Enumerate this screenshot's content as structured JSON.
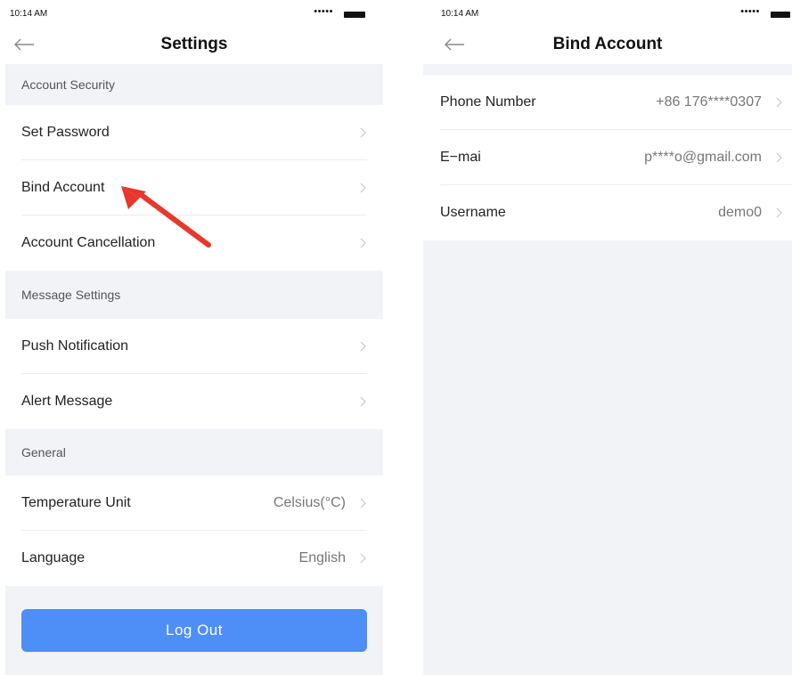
{
  "left": {
    "status": {
      "time": "10:14 AM",
      "signal": "•••••"
    },
    "title": "Settings",
    "sections": [
      {
        "header": "Account Security",
        "rows": [
          {
            "label": "Set Password",
            "value": ""
          },
          {
            "label": "Bind Account",
            "value": ""
          },
          {
            "label": "Account Cancellation",
            "value": ""
          }
        ]
      },
      {
        "header": "Message Settings",
        "rows": [
          {
            "label": "Push Notification",
            "value": ""
          },
          {
            "label": "Alert Message",
            "value": ""
          }
        ]
      },
      {
        "header": "General",
        "rows": [
          {
            "label": "Temperature Unit",
            "value": "Celsius(°C)"
          },
          {
            "label": "Language",
            "value": "English"
          }
        ]
      }
    ],
    "logout_label": "Log  Out"
  },
  "right": {
    "status": {
      "time": "10:14 AM",
      "signal": "•••••"
    },
    "title": "Bind Account",
    "rows": [
      {
        "label": "Phone Number",
        "value": "+86  176****0307"
      },
      {
        "label": "E−mai",
        "value": "p****o@gmail.com"
      },
      {
        "label": "Username",
        "value": "demo0"
      }
    ]
  },
  "colors": {
    "accent": "#4d8ef7",
    "annotation_arrow": "#e8372c",
    "section_bg": "#f2f3f7"
  },
  "icons": {
    "back": "back-arrow-icon",
    "chevron": "chevron-right-icon",
    "battery": "battery-icon"
  }
}
